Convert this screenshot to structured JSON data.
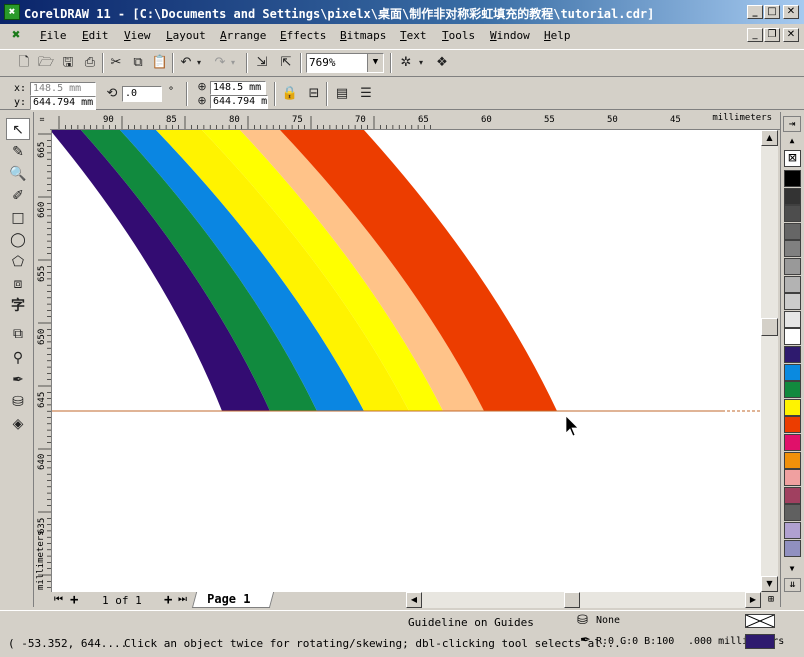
{
  "window": {
    "app_icon": "✖",
    "title": "CorelDRAW 11 - [C:\\Documents and Settings\\pixelx\\桌面\\制作非对称彩虹填充的教程\\tutorial.cdr]"
  },
  "menu": {
    "items": [
      {
        "first": "F",
        "rest": "ile"
      },
      {
        "first": "E",
        "rest": "dit"
      },
      {
        "first": "V",
        "rest": "iew"
      },
      {
        "first": "L",
        "rest": "ayout"
      },
      {
        "first": "A",
        "rest": "rrange"
      },
      {
        "first": "E",
        "rest": "ffects"
      },
      {
        "first": "B",
        "rest": "itmaps"
      },
      {
        "first": "T",
        "rest": "ext"
      },
      {
        "first": "T",
        "rest": "ools"
      },
      {
        "first": "W",
        "rest": "indow"
      },
      {
        "first": "H",
        "rest": "elp"
      }
    ]
  },
  "toolbar": {
    "zoom": "769%",
    "icons": [
      "new-icon",
      "open-icon",
      "save-icon",
      "print-icon",
      "cut-icon",
      "copy-icon",
      "paste-icon",
      "undo-icon",
      "redo-icon",
      "import-icon",
      "export-icon",
      "application-launcher-icon",
      "corel-online-icon"
    ]
  },
  "property_bar": {
    "x_label": "x:",
    "y_label": "y:",
    "x_value": "148.5 mm",
    "y_value": "644.794 mm",
    "rotation": ".0",
    "rotation_unit": "°",
    "x2_value": "148.5 mm",
    "y2_value": "644.794 m"
  },
  "rulers": {
    "top_ticks": [
      "90",
      "85",
      "80",
      "75",
      "70",
      "65",
      "60",
      "55",
      "50",
      "45"
    ],
    "unit": "millimeters",
    "left_ticks": [
      "665",
      "660",
      "655",
      "650",
      "645",
      "640",
      "635"
    ],
    "left_unit": "millimeters"
  },
  "canvas": {
    "stripe_colors": [
      "#330c72",
      "#118a3e",
      "#0a86e2",
      "#fff300",
      "#ffff00",
      "#ffc389",
      "#ec3d00"
    ],
    "guideline_color": "#c0692c"
  },
  "page_nav": {
    "count": "1 of 1",
    "tab": "Page 1"
  },
  "status": {
    "guide": "Guideline on Guides",
    "fill": "None",
    "coords": "( -53.352, 644....",
    "hint": "Click an object twice for rotating/skewing; dbl-clicking tool selects al...",
    "outline_color": "R:0 G:0 B:100",
    "outline_width": ".000 millimeters"
  },
  "palette": {
    "colors": [
      "#000000",
      "#333333",
      "#4d4d4d",
      "#666666",
      "#808080",
      "#999999",
      "#b3b3b3",
      "#cccccc",
      "#e6e6e6",
      "#ffffff",
      "#2e1a6e",
      "#0a8ae0",
      "#118a3e",
      "#fff300",
      "#ec3d00",
      "#e0106a",
      "#f0900a",
      "#f0a0a0",
      "#a04060",
      "#606060",
      "#b0a0d0",
      "#9090c0"
    ]
  }
}
